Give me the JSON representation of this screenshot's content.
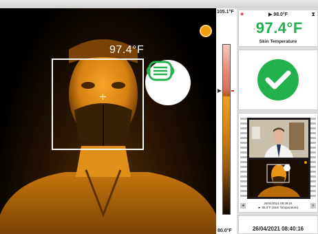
{
  "camera": {
    "measured_temp": "97.4°F",
    "mask_status": "mask-detected",
    "status_color": "#f29c12"
  },
  "scale": {
    "max": "105.1°F",
    "min": "80.0°F"
  },
  "result": {
    "threshold": "▶ 98.0°F",
    "temperature": "97.4°F",
    "indicator": "·",
    "label": "Skin Temperature",
    "status": "pass",
    "color": "#22b14c"
  },
  "capture": {
    "date": "26/04/2021 08:39:24",
    "detail": "► 98.0°F (Skin Temperature)"
  },
  "footer": {
    "timestamp": "26/04/2021 08:40:16"
  }
}
